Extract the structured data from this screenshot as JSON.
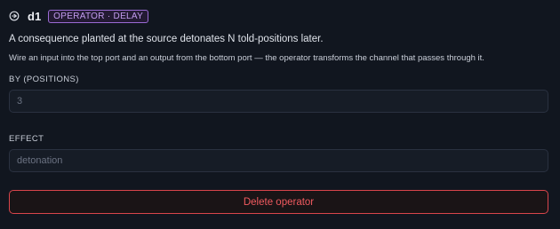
{
  "operator": {
    "icon": "clock-rewind-icon",
    "name": "d1",
    "badge": "OPERATOR · DELAY",
    "description": "A consequence planted at the source detonates N told-positions later.",
    "hint": "Wire an input into the top port and an output from the bottom port — the operator transforms the channel that passes through it."
  },
  "fields": {
    "by": {
      "label": "BY (POSITIONS)",
      "value": "3"
    },
    "effect": {
      "label": "EFFECT",
      "placeholder": "detonation"
    }
  },
  "actions": {
    "delete_label": "Delete operator"
  },
  "colors": {
    "background": "#11161f",
    "badge_purple": "#9b6ad4",
    "danger_red": "#e0484e"
  }
}
